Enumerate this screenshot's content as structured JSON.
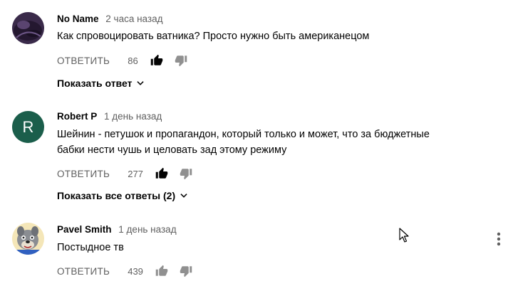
{
  "comments": [
    {
      "author": "No Name",
      "time": "2 часа назад",
      "text_lines": [
        "Как спровоцировать ватника? Просто нужно быть американецом"
      ],
      "reply_label": "ОТВЕТИТЬ",
      "likes": "86",
      "replies_label": "Показать ответ",
      "avatar": "dark-purple-photo"
    },
    {
      "author": "Robert P",
      "time": "1 день назад",
      "text_lines": [
        "Шейнин - петушок и пропагандон, который только и может, что за бюджетные",
        "бабки нести чушь и целовать зад этому режиму"
      ],
      "reply_label": "ОТВЕТИТЬ",
      "likes": "277",
      "replies_label": "Показать все ответы (2)",
      "avatar_letter": "R",
      "avatar_color": "#1b5e4b"
    },
    {
      "author": "Pavel Smith",
      "time": "1 день назад",
      "text_lines": [
        "Постыдное тв"
      ],
      "reply_label": "ОТВЕТИТЬ",
      "likes": "439",
      "avatar": "cartoon-wolf"
    }
  ],
  "icons": {
    "thumb_up": "thumb-up-icon",
    "thumb_down": "thumb-down-icon",
    "chevron": "chevron-down-icon",
    "menu": "more-vert-icon"
  },
  "colors": {
    "primary_text": "#030303",
    "secondary_text": "#606060",
    "thumb_active": "#030303",
    "thumb_inactive": "#909090"
  }
}
